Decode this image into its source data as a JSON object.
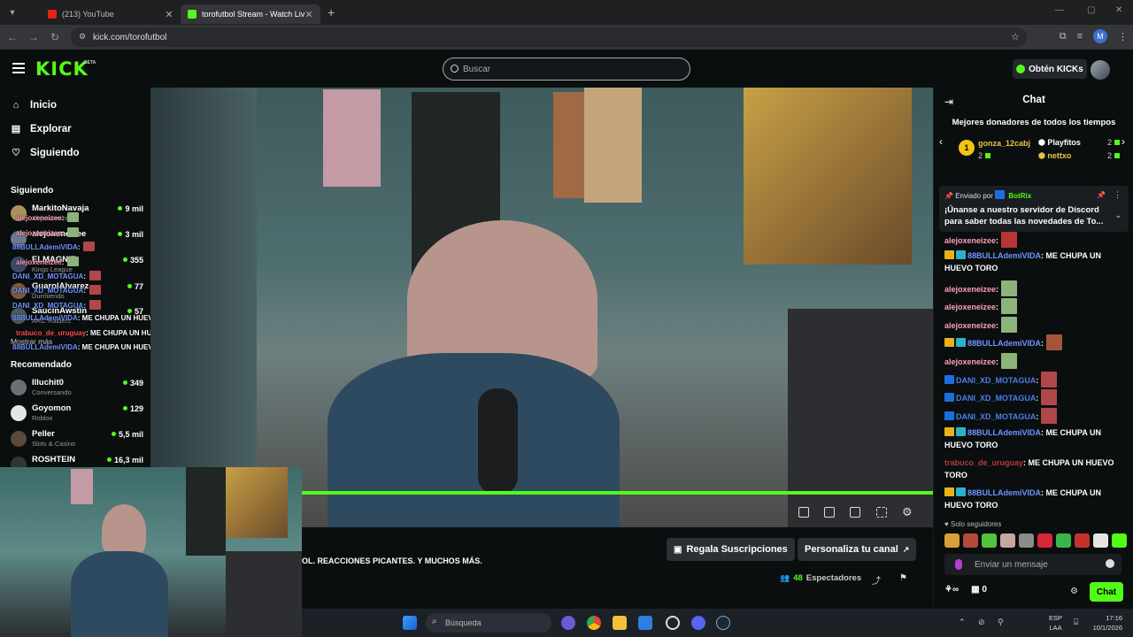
{
  "browser": {
    "tabs": [
      {
        "title": "(213) YouTube",
        "color": "#e62117",
        "active": false
      },
      {
        "title": "torofutbol Stream - Watch Live",
        "color": "#53fc18",
        "active": true
      }
    ],
    "url": "kick.com/torofutbol",
    "profile_initial": "M"
  },
  "header": {
    "logo": "KICK",
    "beta": "BETA",
    "search_placeholder": "Buscar",
    "kicks_button": "Obtén KICKs"
  },
  "sidebar": {
    "nav": [
      {
        "label": "Inicio",
        "icon": "home-icon"
      },
      {
        "label": "Explorar",
        "icon": "compass-icon"
      },
      {
        "label": "Siguiendo",
        "icon": "heart-icon"
      }
    ],
    "following_title": "Siguiendo",
    "following": [
      {
        "name": "MarkitoNavaja",
        "category": "alejoxeneizee",
        "viewers": "9 mil"
      },
      {
        "name": "alejoxeneizee",
        "category": "",
        "viewers": "3 mil"
      },
      {
        "name": "ELMAGNIT",
        "category": "Kings League",
        "viewers": "355"
      },
      {
        "name": "GuarolAlvarez",
        "category": "Durmiendo",
        "viewers": "77"
      },
      {
        "name": "SaucinAwstin",
        "category": "ARC Raiders",
        "viewers": "57"
      }
    ],
    "show_more": "Mostrar más",
    "recommended_title": "Recomendado",
    "recommended": [
      {
        "name": "Illuchit0",
        "category": "Conversando",
        "viewers": "349"
      },
      {
        "name": "Goyomon",
        "category": "Roblox",
        "viewers": "129"
      },
      {
        "name": "Peller",
        "category": "Slots & Casino",
        "viewers": "5,5 mil"
      },
      {
        "name": "ROSHTEIN",
        "category": "",
        "viewers": "16,3 mil"
      }
    ],
    "overlay_chat": [
      {
        "user": "alejoxeneizee",
        "text": ":"
      },
      {
        "user": "alejoxeneizee",
        "text": ":"
      },
      {
        "user": "88BULLAdemiVIDA",
        "text": ":"
      },
      {
        "user": "alejoxeneizee",
        "text": ":"
      },
      {
        "user": "DANI_XD_MOTAGUA",
        "text": ":"
      },
      {
        "user": "DANI_XD_MOTAGUA",
        "text": ":"
      },
      {
        "user": "DANI_XD_MOTAGUA",
        "text": ":"
      },
      {
        "user": "88BULLAdemiVIDA",
        "text": ": ME CHUPA UN HUEVO TORO"
      },
      {
        "user": "trabuco_de_uruguay",
        "text": ": ME CHUPA UN HUEVO TORO"
      },
      {
        "user": "88BULLAdemiVIDA",
        "text": ": ME CHUPA UN HUEVO TORO"
      }
    ]
  },
  "stream": {
    "title": "OL. REACCIONES PICANTES. Y MUCHOS MÁS.",
    "gift_button": "Regala Suscripciones",
    "customize_button": "Personaliza tu canal",
    "viewers_count": "48",
    "viewers_label": "Espectadores",
    "progress": 1.0
  },
  "chat": {
    "title": "Chat",
    "top_donors_title": "Mejores donadores de todos los tiempos",
    "donors": [
      {
        "rank": "1",
        "name": "gonza_12cabj",
        "count": "2"
      },
      {
        "name": "Playfitos",
        "count": "2"
      },
      {
        "name": "nettxo",
        "count": "2"
      }
    ],
    "pinned": {
      "prefix": "Enviado por",
      "bot": "BotRix",
      "message": "¡Únanse a nuestro servidor de Discord para saber todas las novedades de To..."
    },
    "messages": [
      {
        "user": "alejoxeneizee",
        "text": ":"
      },
      {
        "user": "88BULLAdemiVIDA",
        "text": ": ME CHUPA UN HUEVO TORO"
      },
      {
        "user": "alejoxeneizee",
        "text": ":"
      },
      {
        "user": "alejoxeneizee",
        "text": ":"
      },
      {
        "user": "alejoxeneizee",
        "text": ":"
      },
      {
        "user": "88BULLAdemiVIDA",
        "text": ":"
      },
      {
        "user": "alejoxeneizee",
        "text": ":"
      },
      {
        "user": "DANI_XD_MOTAGUA",
        "text": ":"
      },
      {
        "user": "DANI_XD_MOTAGUA",
        "text": ":"
      },
      {
        "user": "DANI_XD_MOTAGUA",
        "text": ":"
      },
      {
        "user": "88BULLAdemiVIDA",
        "text": ": ME CHUPA UN HUEVO TORO"
      },
      {
        "user": "trabuco_de_uruguay",
        "text": ": ME CHUPA UN HUEVO TORO"
      },
      {
        "user": "88BULLAdemiVIDA",
        "text": ": ME CHUPA UN HUEVO TORO"
      }
    ],
    "followers_only": "Solo seguidores",
    "input_placeholder": "Enviar un mensaje",
    "footer_points": "0",
    "send_button": "Chat"
  },
  "taskbar": {
    "search_placeholder": "Búsqueda",
    "lang_top": "ESP",
    "lang_bottom": "LAA",
    "time": "17:16",
    "date": "10/1/2026"
  },
  "colors": {
    "accent": "#53fc18",
    "background": "#0b0e0f"
  }
}
